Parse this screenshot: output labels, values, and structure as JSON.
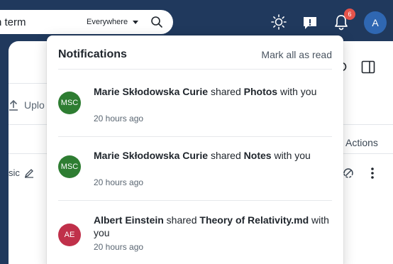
{
  "search": {
    "value": "h term",
    "placeholder": "",
    "scope": "Everywhere"
  },
  "topbar": {
    "notification_count": "6",
    "avatar_initial": "A"
  },
  "background": {
    "upload_label": "Uplo",
    "actions_label": "Actions",
    "basic_label": "sic"
  },
  "notifications": {
    "title": "Notifications",
    "mark_all": "Mark all as read",
    "items": [
      {
        "initials": "MSC",
        "color": "#2e7d32",
        "actor": "Marie Skłodowska Curie",
        "verb": " shared ",
        "object": "Photos",
        "suffix": " with you",
        "time": "20 hours ago"
      },
      {
        "initials": "MSC",
        "color": "#2e7d32",
        "actor": "Marie Skłodowska Curie",
        "verb": " shared ",
        "object": "Notes",
        "suffix": " with you",
        "time": "20 hours ago"
      },
      {
        "initials": "AE",
        "color": "#c0304a",
        "actor": "Albert Einstein",
        "verb": " shared ",
        "object": "Theory of Relativity.md",
        "suffix": " with you",
        "time": "20 hours ago"
      }
    ]
  }
}
